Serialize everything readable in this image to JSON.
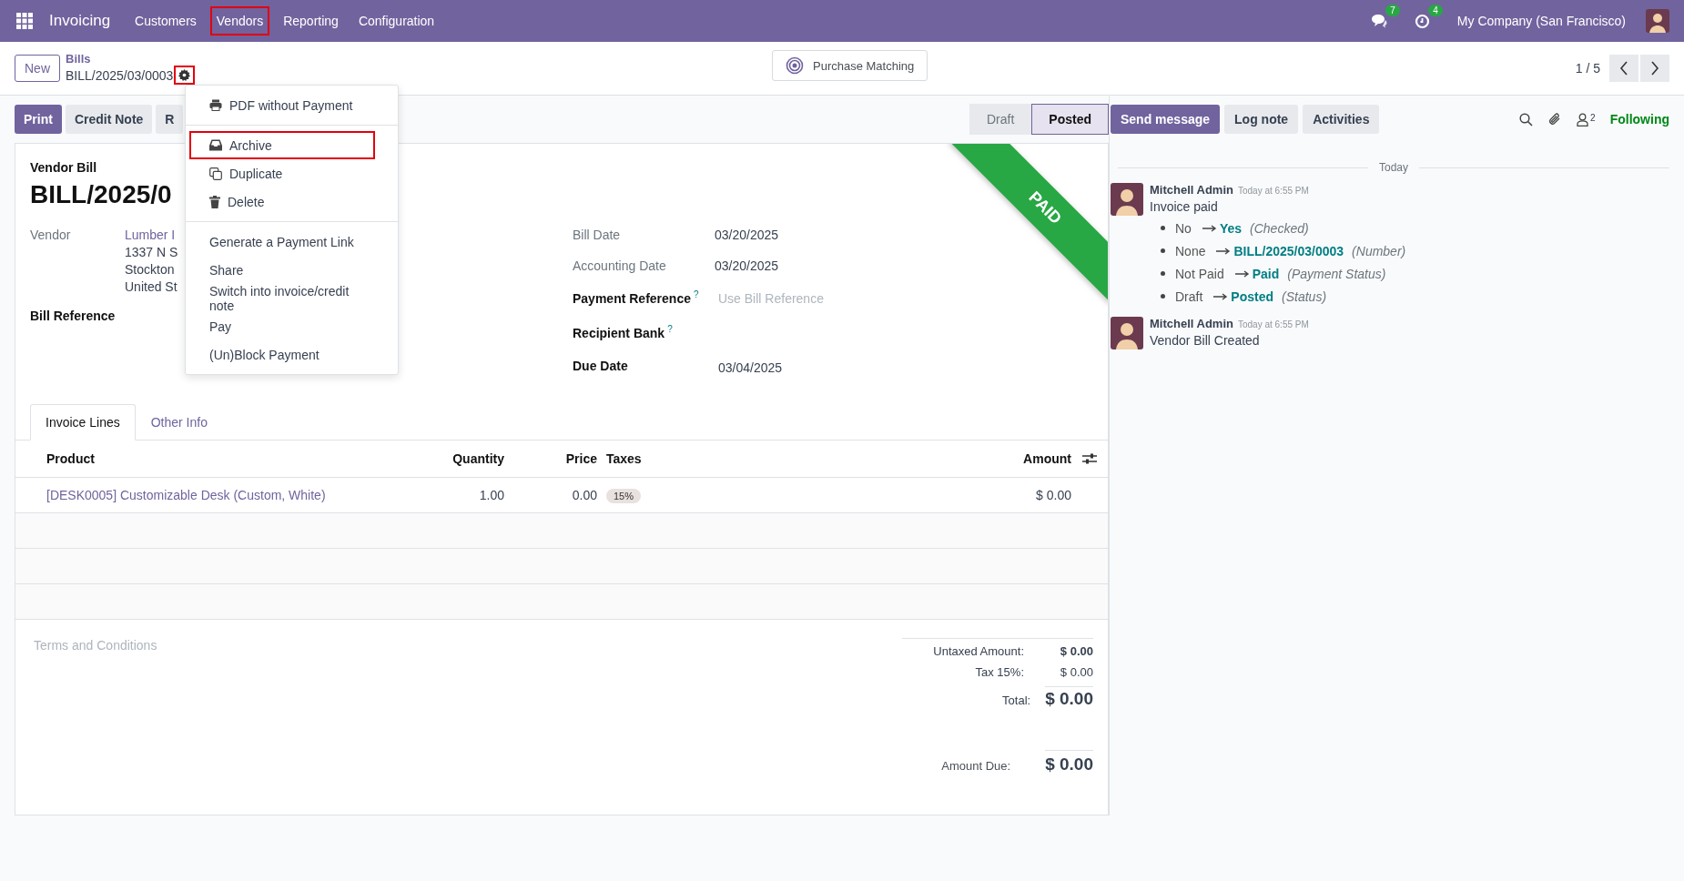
{
  "navbar": {
    "app_name": "Invoicing",
    "menus": [
      {
        "label": "Customers",
        "highlighted": false
      },
      {
        "label": "Vendors",
        "highlighted": true
      },
      {
        "label": "Reporting",
        "highlighted": false
      },
      {
        "label": "Configuration",
        "highlighted": false
      }
    ],
    "messages_count": "7",
    "activities_count": "4",
    "company": "My Company (San Francisco)"
  },
  "header": {
    "new_button": "New",
    "breadcrumb_parent": "Bills",
    "breadcrumb_current": "BILL/2025/03/0003",
    "gear_highlighted": true,
    "smart_button": "Purchase Matching",
    "pager": "1 / 5"
  },
  "actions": [
    {
      "label": "Print",
      "kind": "primary"
    },
    {
      "label": "Credit Note",
      "kind": "secondary"
    },
    {
      "label": "R",
      "kind": "secondary"
    }
  ],
  "status_steps": [
    {
      "label": "Draft",
      "selected": false
    },
    {
      "label": "Posted",
      "selected": true
    }
  ],
  "ribbon": "PAID",
  "form": {
    "title_label": "Vendor Bill",
    "name": "BILL/2025/0",
    "vendor_label": "Vendor",
    "vendor_link": "Lumber I",
    "vendor_address": [
      "1337 N S",
      "Stockton",
      "United St"
    ],
    "bill_reference_label": "Bill Reference",
    "right_fields": [
      {
        "label": "Bill Date",
        "value": "03/20/2025",
        "kind": "plain"
      },
      {
        "label": "Accounting Date",
        "value": "03/20/2025",
        "kind": "plain"
      },
      {
        "label": "Payment Reference",
        "placeholder": "Use Bill Reference",
        "kind": "required",
        "help": "?"
      },
      {
        "label": "Recipient Bank",
        "kind": "required",
        "help": "?"
      },
      {
        "label": "Due Date",
        "value": "03/04/2025",
        "kind": "required"
      }
    ]
  },
  "tabs": [
    {
      "label": "Invoice Lines",
      "selected": true
    },
    {
      "label": "Other Info",
      "selected": false
    }
  ],
  "table": {
    "columns": [
      "Product",
      "Quantity",
      "Price",
      "Taxes",
      "Amount"
    ],
    "rows": [
      {
        "product": "[DESK0005] Customizable Desk (Custom, White)",
        "quantity": "1.00",
        "price": "0.00",
        "taxes": "15%",
        "amount": "$ 0.00"
      }
    ]
  },
  "terms_placeholder": "Terms and Conditions",
  "totals": [
    {
      "label": "Untaxed Amount:",
      "value": "$ 0.00",
      "kind": "bold"
    },
    {
      "label": "Tax 15%:",
      "value": "$ 0.00",
      "kind": "plain"
    },
    {
      "label": "Total:",
      "value": "$ 0.00",
      "kind": "total"
    },
    {
      "label": "Amount Due:",
      "value": "$ 0.00",
      "kind": "due"
    }
  ],
  "gear_menu": [
    [
      {
        "label": "PDF without Payment",
        "highlighted": false
      }
    ],
    [
      {
        "label": "Archive",
        "highlighted": true
      },
      {
        "label": "Duplicate",
        "highlighted": false
      },
      {
        "label": "Delete",
        "highlighted": false
      }
    ],
    [
      {
        "label": "Generate a Payment Link",
        "highlighted": false
      },
      {
        "label": "Share",
        "highlighted": false
      },
      {
        "label": "Switch into invoice/credit note",
        "highlighted": false
      },
      {
        "label": "Pay",
        "highlighted": false
      },
      {
        "label": "(Un)Block Payment",
        "highlighted": false
      }
    ]
  ],
  "chatter": {
    "buttons": [
      {
        "label": "Send message",
        "selected": true
      },
      {
        "label": "Log note",
        "selected": false
      },
      {
        "label": "Activities",
        "selected": false
      }
    ],
    "follower_count": "2",
    "following": "Following",
    "date_divider": "Today",
    "messages": [
      {
        "author": "Mitchell Admin",
        "time": "Today at 6:55 PM",
        "body": "Invoice paid",
        "changes": [
          {
            "old": "No",
            "new": "Yes",
            "field": "(Checked)"
          },
          {
            "old": "None",
            "new": "BILL/2025/03/0003",
            "field": "(Number)"
          },
          {
            "old": "Not Paid",
            "new": "Paid",
            "field": "(Payment Status)"
          },
          {
            "old": "Draft",
            "new": "Posted",
            "field": "(Status)"
          }
        ]
      },
      {
        "author": "Mitchell Admin",
        "time": "Today at 6:55 PM",
        "body": "Vendor Bill Created"
      }
    ]
  }
}
